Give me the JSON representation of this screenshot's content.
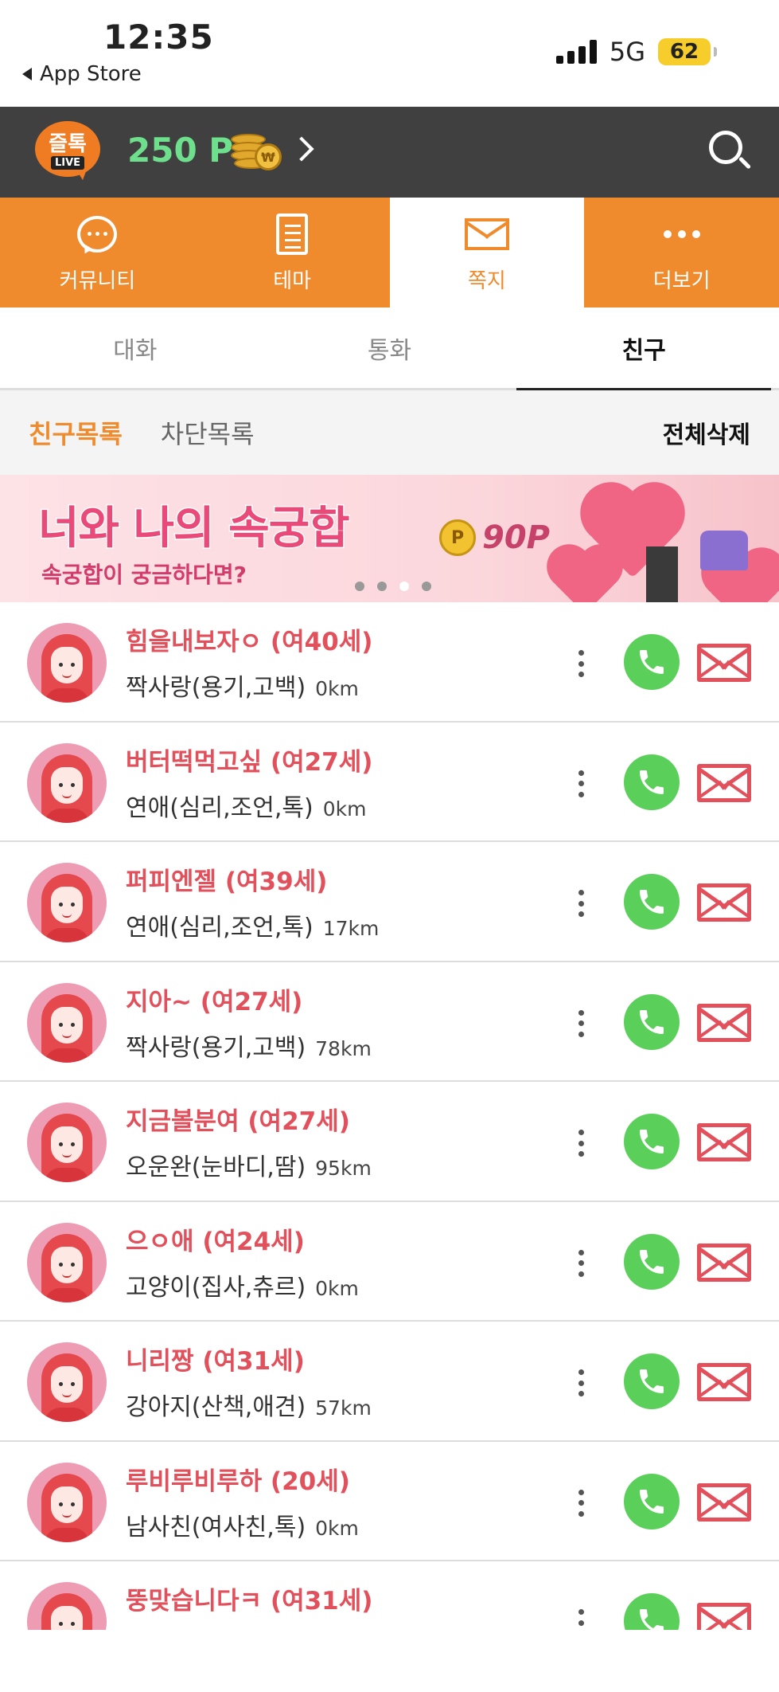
{
  "status_bar": {
    "time": "12:35",
    "back_label": "App Store",
    "network": "5G",
    "battery": "62"
  },
  "header": {
    "logo_text": "즐톡",
    "logo_badge": "LIVE",
    "points": "250 P",
    "coin_symbol": "₩",
    "accent_color": "#ef8b2c"
  },
  "main_tabs": [
    {
      "label": "커뮤니티",
      "icon": "chat-bubble-icon"
    },
    {
      "label": "테마",
      "icon": "document-icon"
    },
    {
      "label": "쪽지",
      "icon": "mail-icon",
      "active": true
    },
    {
      "label": "더보기",
      "icon": "more-dots-icon"
    }
  ],
  "sub_tabs": [
    {
      "label": "대화"
    },
    {
      "label": "통화"
    },
    {
      "label": "친구",
      "active": true
    }
  ],
  "filter": {
    "friends_label": "친구목록",
    "blocked_label": "차단목록",
    "delete_all_label": "전체삭제"
  },
  "banner": {
    "title": "너와 나의 속궁합",
    "subtitle": "속궁합이 궁금하다면?",
    "coin_letter": "P",
    "point_value": "90P",
    "slide_count": 4,
    "active_slide": 3
  },
  "friends": [
    {
      "name": "힘을내보자ㅇ (여40세)",
      "interest": "짝사랑(용기,고백)",
      "distance": "0km"
    },
    {
      "name": "버터떡먹고싶 (여27세)",
      "interest": "연애(심리,조언,톡)",
      "distance": "0km"
    },
    {
      "name": "퍼피엔젤 (여39세)",
      "interest": "연애(심리,조언,톡)",
      "distance": "17km"
    },
    {
      "name": "지아~ (여27세)",
      "interest": "짝사랑(용기,고백)",
      "distance": "78km"
    },
    {
      "name": "지금볼분여 (여27세)",
      "interest": "오운완(눈바디,땀)",
      "distance": "95km"
    },
    {
      "name": "으ㅇ애 (여24세)",
      "interest": "고양이(집사,츄르)",
      "distance": "0km"
    },
    {
      "name": "니리짱 (여31세)",
      "interest": "강아지(산책,애견)",
      "distance": "57km"
    },
    {
      "name": "루비루비루하 (20세)",
      "interest": "남사친(여사친,톡)",
      "distance": "0km"
    },
    {
      "name": "뚱맞습니다ㅋ (여31세)",
      "interest": "",
      "distance": ""
    }
  ]
}
